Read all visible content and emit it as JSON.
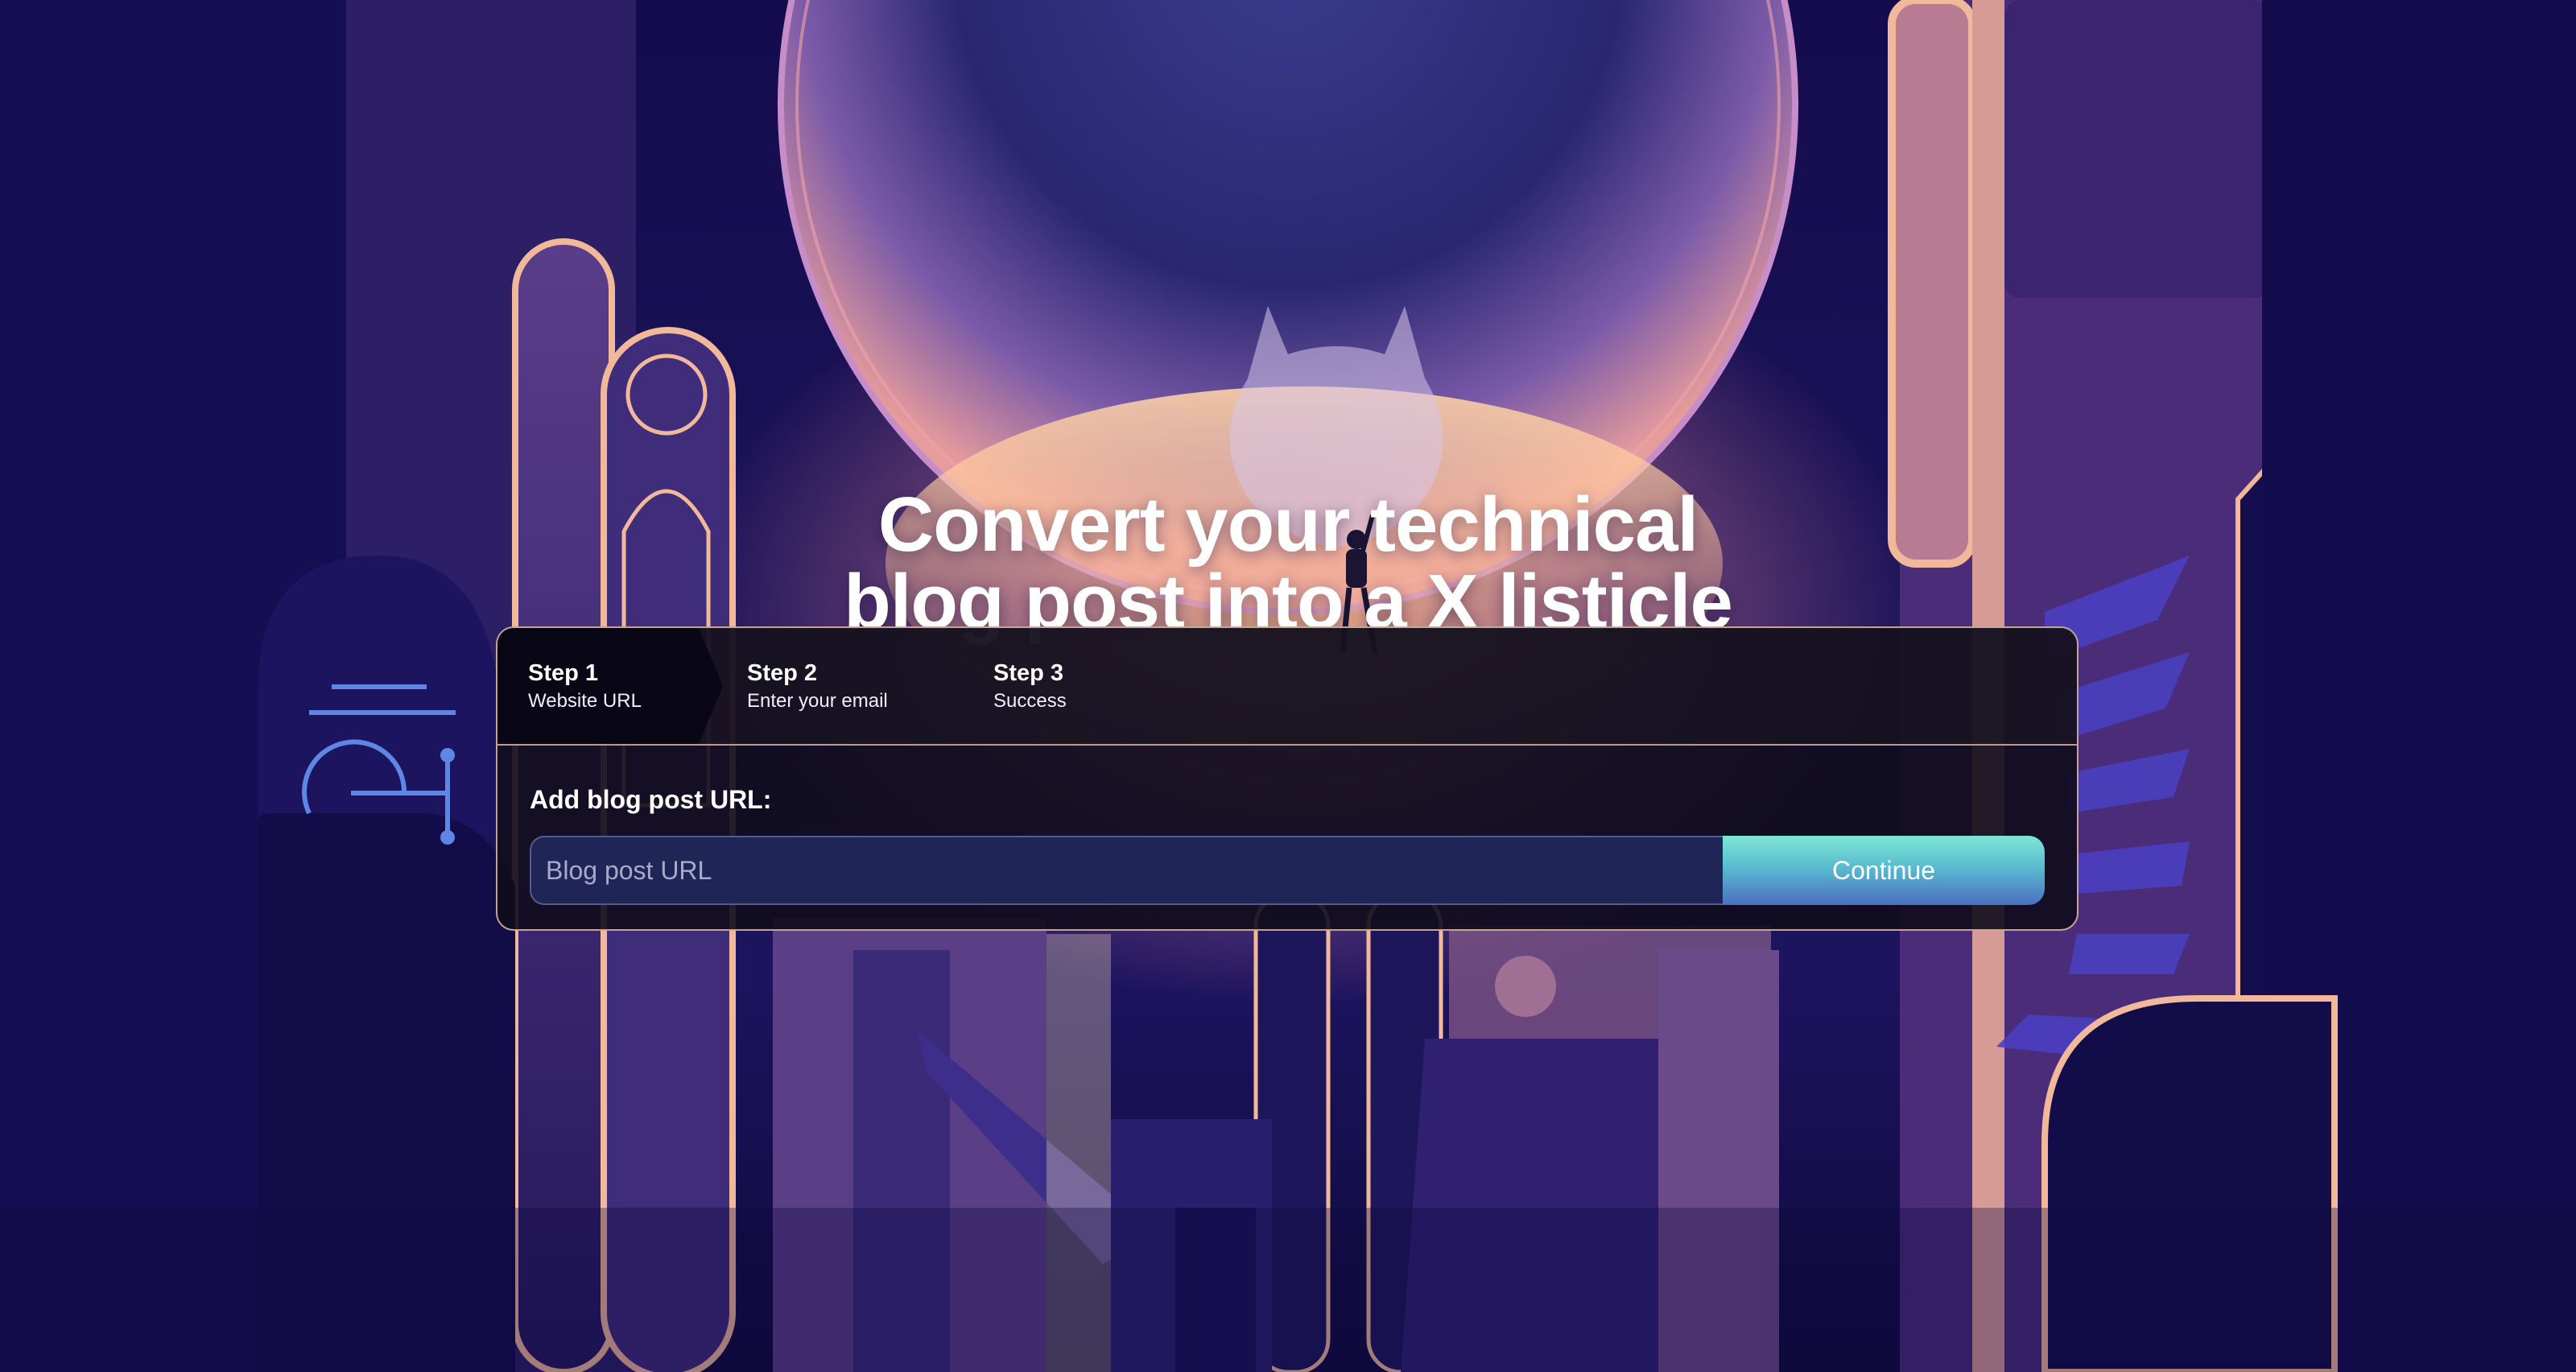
{
  "hero": {
    "title_line1": "Convert your technical",
    "title_line2": "blog post into a X listicle"
  },
  "steps": [
    {
      "title": "Step 1",
      "subtitle": "Website URL",
      "active": true
    },
    {
      "title": "Step 2",
      "subtitle": "Enter your email",
      "active": false
    },
    {
      "title": "Step 3",
      "subtitle": "Success",
      "active": false
    }
  ],
  "form": {
    "label": "Add blog post URL:",
    "input_placeholder": "Blog post URL",
    "input_value": "",
    "submit_label": "Continue"
  },
  "colors": {
    "background": "#120c4a",
    "accent_gradient_start": "#7fe6d4",
    "accent_gradient_end": "#4b6fc2",
    "panel_border": "#ffd7b9"
  },
  "background_art": {
    "description_icon": "github-octocat-icon"
  }
}
